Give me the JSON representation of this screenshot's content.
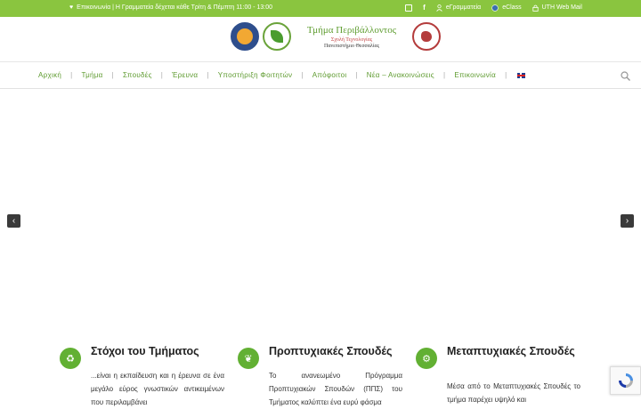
{
  "topbar": {
    "notice": "Επικοινωνία | Η Γραμματεία δέχεται κάθε Τρίτη & Πέμπτη 11:00 - 13:00",
    "links": [
      {
        "label": "eΓραμματεία"
      },
      {
        "label": "eClass"
      },
      {
        "label": "UTH Web Mail"
      }
    ]
  },
  "header": {
    "title": "Τμήμα Περιβάλλοντος",
    "school": "Σχολή Τεχνολογίας",
    "university": "Πανεπιστήμιο Θεσσαλίας"
  },
  "nav": {
    "items": [
      {
        "label": "Αρχική"
      },
      {
        "label": "Τμήμα"
      },
      {
        "label": "Σπουδές"
      },
      {
        "label": "Έρευνα"
      },
      {
        "label": "Υποστήριξη Φοιτητών"
      },
      {
        "label": "Απόφοιτοι"
      },
      {
        "label": "Νέα – Ανακοινώσεις"
      },
      {
        "label": "Επικοινωνία"
      }
    ]
  },
  "slider": {
    "prev": "‹",
    "next": "›"
  },
  "features": [
    {
      "title": "Στόχοι του Τμήματος",
      "text": "...είναι η εκπαίδευση και η έρευνα σε ένα μεγάλο εύρος γνωστικών αντικειμένων που περιλαμβάνει"
    },
    {
      "title": "Προπτυχιακές Σπουδές",
      "text": "Το ανανεωμένο Πρόγραμμα Προπτυχιακών Σπουδών (ΠΠΣ) του Τμήματος καλύπτει ένα ευρύ φάσμα"
    },
    {
      "title": "Μεταπτυχιακές Σπουδές",
      "text": "Μέσα από το Μεταπτυχιακές Σπουδές το τμήμα παρέχει υψηλό και"
    }
  ],
  "colors": {
    "accent": "#8ac53f",
    "nav_text": "#5d9a2e",
    "icon_bg": "#62b033"
  }
}
